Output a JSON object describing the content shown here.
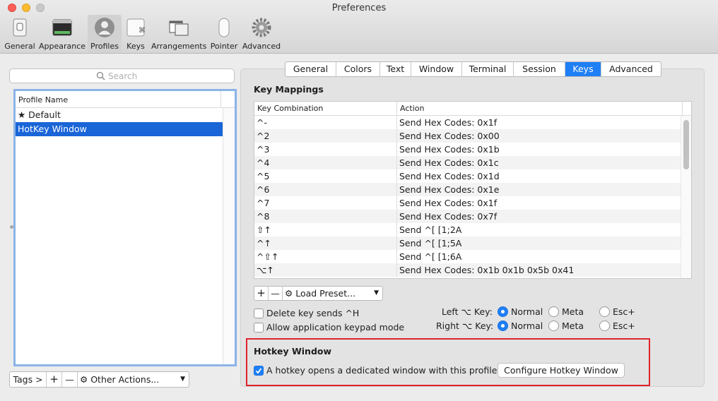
{
  "window": {
    "title": "Preferences"
  },
  "toolbar": {
    "items": [
      {
        "label": "General",
        "icon": "switch-icon"
      },
      {
        "label": "Appearance",
        "icon": "terminal-icon"
      },
      {
        "label": "Profiles",
        "icon": "profile-icon",
        "selected": true
      },
      {
        "label": "Keys",
        "icon": "command-key-icon"
      },
      {
        "label": "Arrangements",
        "icon": "window-arrangement-icon"
      },
      {
        "label": "Pointer",
        "icon": "mouse-icon"
      },
      {
        "label": "Advanced",
        "icon": "gear-icon"
      }
    ]
  },
  "sidebar": {
    "search_placeholder": "Search",
    "list_header": "Profile Name",
    "profiles": [
      {
        "name": "★ Default",
        "selected": false
      },
      {
        "name": "HotKey Window",
        "selected": true
      }
    ],
    "tags_label": "Tags >",
    "add_label": "+",
    "remove_label": "—",
    "other_actions_label": "Other Actions..."
  },
  "tabs": [
    {
      "label": "General"
    },
    {
      "label": "Colors"
    },
    {
      "label": "Text"
    },
    {
      "label": "Window"
    },
    {
      "label": "Terminal"
    },
    {
      "label": "Session"
    },
    {
      "label": "Keys",
      "active": true
    },
    {
      "label": "Advanced"
    }
  ],
  "key_mappings": {
    "title": "Key Mappings",
    "col_key": "Key Combination",
    "col_action": "Action",
    "rows": [
      {
        "key": "^-",
        "action": "Send Hex Codes: 0x1f"
      },
      {
        "key": "^2",
        "action": "Send Hex Codes: 0x00"
      },
      {
        "key": "^3",
        "action": "Send Hex Codes: 0x1b"
      },
      {
        "key": "^4",
        "action": "Send Hex Codes: 0x1c"
      },
      {
        "key": "^5",
        "action": "Send Hex Codes: 0x1d"
      },
      {
        "key": "^6",
        "action": "Send Hex Codes: 0x1e"
      },
      {
        "key": "^7",
        "action": "Send Hex Codes: 0x1f"
      },
      {
        "key": "^8",
        "action": "Send Hex Codes: 0x7f"
      },
      {
        "key": "⇧↑",
        "action": "Send ^[ [1;2A"
      },
      {
        "key": "^↑",
        "action": "Send ^[ [1;5A"
      },
      {
        "key": "^⇧↑",
        "action": "Send ^[ [1;6A"
      },
      {
        "key": "⌥↑",
        "action": "Send Hex Codes: 0x1b 0x1b 0x5b 0x41"
      }
    ],
    "add_label": "+",
    "remove_label": "—",
    "load_preset_label": "Load Preset..."
  },
  "options": {
    "delete_key_label": "Delete key sends ^H",
    "delete_key_checked": false,
    "keypad_label": "Allow application keypad mode",
    "keypad_checked": false,
    "left_option_label": "Left ⌥ Key:",
    "right_option_label": "Right ⌥ Key:",
    "radio_normal": "Normal",
    "radio_meta": "Meta",
    "radio_esc": "Esc+",
    "left_selected": "Normal",
    "right_selected": "Normal"
  },
  "hotkey": {
    "title": "Hotkey Window",
    "checkbox_label": "A hotkey opens a dedicated window with this profile.",
    "checked": true,
    "configure_label": "Configure Hotkey Window"
  },
  "colors": {
    "accent": "#1f7ff5",
    "highlight_border": "#e0242a",
    "selection": "#1a65d8"
  }
}
